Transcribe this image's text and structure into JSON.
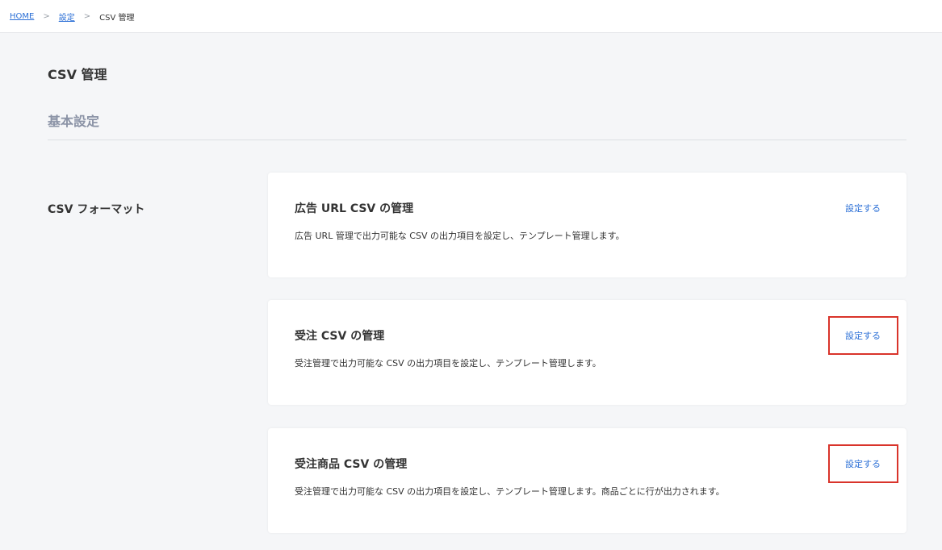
{
  "breadcrumb": {
    "home": "HOME",
    "settings": "設定",
    "current": "CSV 管理",
    "separator": ">"
  },
  "page": {
    "title": "CSV 管理",
    "section_heading": "基本設定",
    "row_label": "CSV フォーマット"
  },
  "cards": [
    {
      "title": "広告 URL CSV の管理",
      "description": "広告 URL 管理で出力可能な CSV の出力項目を設定し、テンプレート管理します。",
      "action": "設定する"
    },
    {
      "title": "受注 CSV の管理",
      "description": "受注管理で出力可能な CSV の出力項目を設定し、テンプレート管理します。",
      "action": "設定する"
    },
    {
      "title": "受注商品 CSV の管理",
      "description": "受注管理で出力可能な CSV の出力項目を設定し、テンプレート管理します。商品ごとに行が出力されます。",
      "action": "設定する"
    }
  ],
  "colors": {
    "link": "#2b6fd6",
    "highlight": "#d9342b",
    "section_heading": "#8b93a6",
    "background": "#f5f6f8"
  }
}
